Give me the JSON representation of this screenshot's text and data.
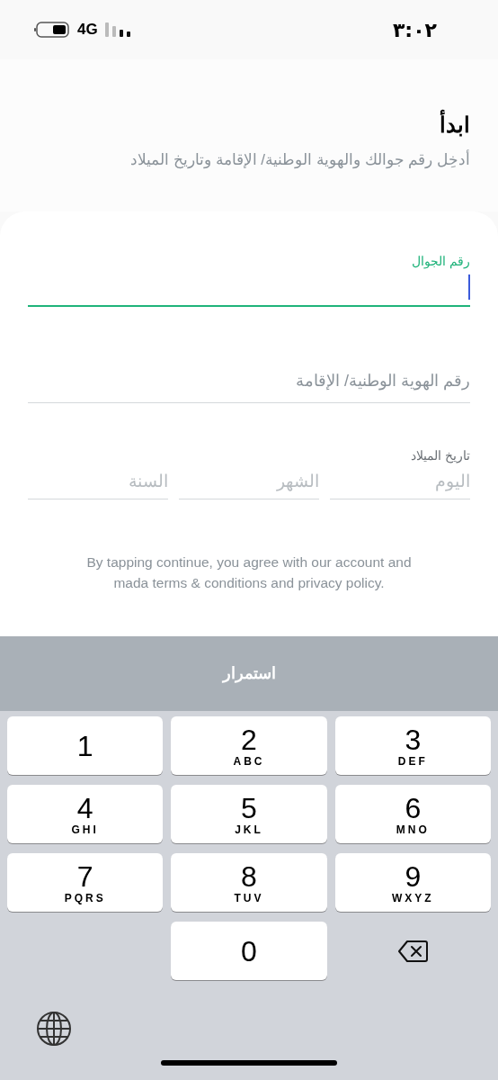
{
  "status_bar": {
    "time": "٣:٠٢",
    "network": "4G"
  },
  "header": {
    "title": "ابدأ",
    "subtitle": "أدخِل رقم جوالك والهوية الوطنية/ الإقامة وتاريخ الميلاد"
  },
  "fields": [
    {
      "label": "رقم الجوال",
      "focused": true
    },
    {
      "label": "رقم الهوية الوطنية/ الإقامة",
      "focused": false
    }
  ],
  "birth_date": {
    "label": "تاريخ الميلاد",
    "parts": [
      {
        "placeholder": "اليوم"
      },
      {
        "placeholder": "الشهر"
      },
      {
        "placeholder": "السنة"
      }
    ]
  },
  "terms": "By tapping continue, you agree with our account and mada terms & conditions and privacy policy.",
  "continue_button": {
    "label": "استمرار",
    "disabled": true
  },
  "keyboard": {
    "rows": [
      {
        "keys": [
          {
            "kind": "digit",
            "digit": "3",
            "letters": "DEF"
          },
          {
            "kind": "digit",
            "digit": "2",
            "letters": "ABC"
          },
          {
            "kind": "digit",
            "digit": "1"
          }
        ]
      },
      {
        "keys": [
          {
            "kind": "digit",
            "digit": "6",
            "letters": "MNO"
          },
          {
            "kind": "digit",
            "digit": "5",
            "letters": "JKL"
          },
          {
            "kind": "digit",
            "digit": "4",
            "letters": "GHI"
          }
        ]
      },
      {
        "keys": [
          {
            "kind": "digit",
            "digit": "9",
            "letters": "WXYZ"
          },
          {
            "kind": "digit",
            "digit": "8",
            "letters": "TUV"
          },
          {
            "kind": "digit",
            "digit": "7",
            "letters": "PQRS"
          }
        ]
      },
      {
        "keys": [
          {
            "kind": "delete"
          },
          {
            "kind": "digit",
            "digit": "0"
          },
          {
            "kind": "blank"
          }
        ]
      }
    ]
  }
}
